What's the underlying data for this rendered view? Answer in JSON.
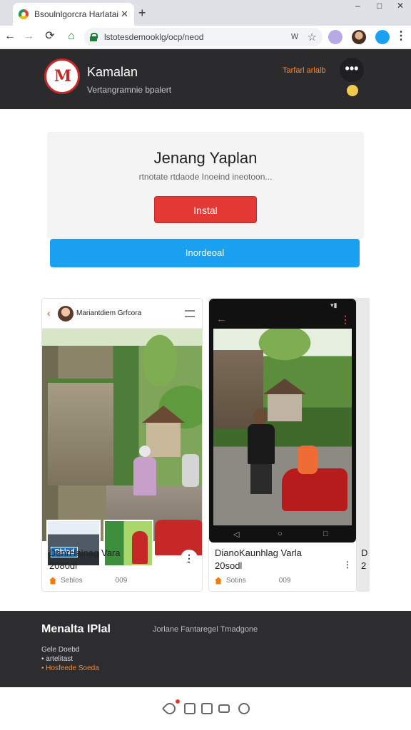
{
  "browser": {
    "tab_title": "Bsoulnlgorcra Harlatai",
    "tab_close": "✕",
    "new_tab": "+",
    "window_controls": [
      "–",
      "□",
      "✕"
    ],
    "nav": {
      "back": "←",
      "forward": "→",
      "reload": "⟳",
      "home": "⌂"
    },
    "url": "lstotesdemooklg/ocp/neod",
    "omnibox_right": "Ꮃ",
    "bookmark_star": "☆",
    "menu": "⋮"
  },
  "header": {
    "logo_text": "M",
    "site_name": "Kamalan",
    "tagline": "Vertangramnie bpalert",
    "link": "Tarfarl arlalb",
    "more": "•••"
  },
  "install_card": {
    "title": "Jenang Yaplan",
    "subtitle": "rtnotate rtdaode Inoeind ineotoon...",
    "install_label": "Instal",
    "download_label": "Inordeoal"
  },
  "cards": [
    {
      "user": "Mariantdiem Grfcora",
      "photo_badge": "Oblad",
      "more": "⋮",
      "title": "DenrHalnag Vara",
      "year": "2080dl",
      "meta_label": "Seblos",
      "meta_count": "009",
      "side_icon": "⌃"
    },
    {
      "title": "DianoKaunhlag Varla",
      "year": "20sodl",
      "meta_label": "Sotins",
      "meta_count": "009",
      "side_icon": "⋮",
      "status_time": "▾▮",
      "back": "←",
      "dots": "⋮",
      "nav_back": "◁",
      "nav_home": "○",
      "nav_recent": "□"
    }
  ],
  "peek_card": {
    "letter_1": "D",
    "letter_2": "2"
  },
  "footer": {
    "brand": "Menalta IPlal",
    "description": "Jorlane Fantaregel Tmadgone",
    "links": [
      "Gele Doebd",
      "• artelitast",
      "• Hosfeede Soeda"
    ]
  },
  "colors": {
    "header_bg": "#2b2b2e",
    "install_red": "#e53935",
    "download_blue": "#1ba1f2",
    "accent_orange": "#f5893b",
    "footer_bg": "#2d2d30"
  },
  "icons": [
    "shield-icon",
    "save-icon",
    "doc-icon",
    "mail-icon",
    "refresh-icon"
  ]
}
